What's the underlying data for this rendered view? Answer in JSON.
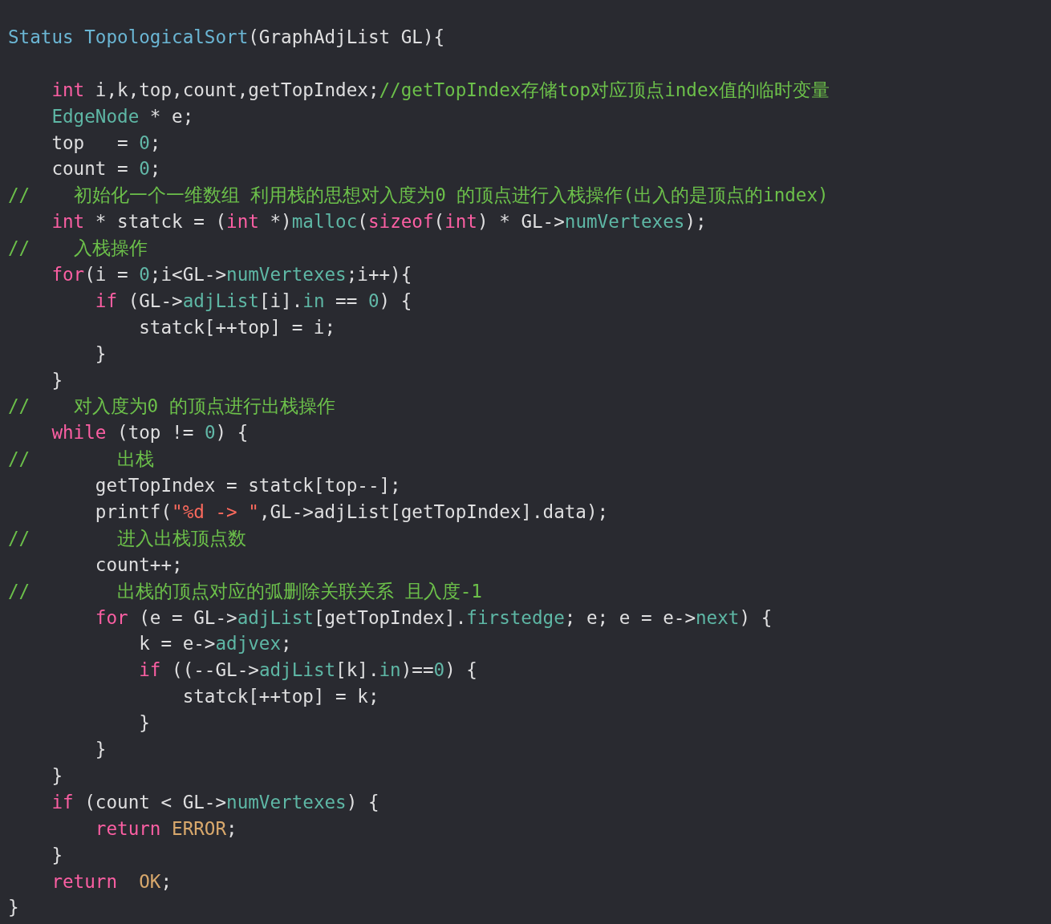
{
  "editor": {
    "header_line": [
      {
        "text": "Status ",
        "kind": "type"
      },
      {
        "text": "TopologicalSort",
        "kind": "type"
      },
      {
        "text": "(GraphAdjList GL){",
        "kind": "plain"
      }
    ],
    "lines": [
      [
        {
          "text": "    int",
          "kind": "keyword"
        },
        {
          "text": " i,k,top,count,getTopIndex;",
          "kind": "plain"
        },
        {
          "text": "//getTopIndex存储top对应顶点index值的临时变量",
          "kind": "comment"
        }
      ],
      [
        {
          "text": "    EdgeNode",
          "kind": "member"
        },
        {
          "text": " * e;",
          "kind": "plain"
        }
      ],
      [
        {
          "text": "    top   = ",
          "kind": "plain"
        },
        {
          "text": "0",
          "kind": "number"
        },
        {
          "text": ";",
          "kind": "plain"
        }
      ],
      [
        {
          "text": "    count = ",
          "kind": "plain"
        },
        {
          "text": "0",
          "kind": "number"
        },
        {
          "text": ";",
          "kind": "plain"
        }
      ],
      [
        {
          "text": "//    初始化一个一维数组 利用栈的思想对入度为0 的顶点进行入栈操作(出入的是顶点的index)",
          "kind": "comment"
        }
      ],
      [
        {
          "text": "    int",
          "kind": "keyword"
        },
        {
          "text": " * statck = (",
          "kind": "plain"
        },
        {
          "text": "int",
          "kind": "keyword"
        },
        {
          "text": " *)",
          "kind": "plain"
        },
        {
          "text": "malloc",
          "kind": "member"
        },
        {
          "text": "(",
          "kind": "plain"
        },
        {
          "text": "sizeof",
          "kind": "keyword"
        },
        {
          "text": "(",
          "kind": "plain"
        },
        {
          "text": "int",
          "kind": "keyword"
        },
        {
          "text": ") * GL->",
          "kind": "plain"
        },
        {
          "text": "numVertexes",
          "kind": "member"
        },
        {
          "text": ");",
          "kind": "plain"
        }
      ],
      [
        {
          "text": "//    入栈操作",
          "kind": "comment"
        }
      ],
      [
        {
          "text": "    for",
          "kind": "keyword"
        },
        {
          "text": "(i = ",
          "kind": "plain"
        },
        {
          "text": "0",
          "kind": "number"
        },
        {
          "text": ";i<GL->",
          "kind": "plain"
        },
        {
          "text": "numVertexes",
          "kind": "member"
        },
        {
          "text": ";i++){",
          "kind": "plain"
        }
      ],
      [
        {
          "text": "        if",
          "kind": "keyword"
        },
        {
          "text": " (GL->",
          "kind": "plain"
        },
        {
          "text": "adjList",
          "kind": "member"
        },
        {
          "text": "[i].",
          "kind": "plain"
        },
        {
          "text": "in",
          "kind": "member"
        },
        {
          "text": " == ",
          "kind": "plain"
        },
        {
          "text": "0",
          "kind": "number"
        },
        {
          "text": ") {",
          "kind": "plain"
        }
      ],
      [
        {
          "text": "            statck[++top] = i;",
          "kind": "plain"
        }
      ],
      [
        {
          "text": "        }",
          "kind": "plain"
        }
      ],
      [
        {
          "text": "    }",
          "kind": "plain"
        }
      ],
      [
        {
          "text": "//    对入度为0 的顶点进行出栈操作",
          "kind": "comment"
        }
      ],
      [
        {
          "text": "    while",
          "kind": "keyword"
        },
        {
          "text": " (top != ",
          "kind": "plain"
        },
        {
          "text": "0",
          "kind": "number"
        },
        {
          "text": ") {",
          "kind": "plain"
        }
      ],
      [
        {
          "text": "//        出栈",
          "kind": "comment"
        }
      ],
      [
        {
          "text": "        getTopIndex = statck[top--];",
          "kind": "plain"
        }
      ],
      [
        {
          "text": "        printf(",
          "kind": "plain"
        },
        {
          "text": "\"%d -> \"",
          "kind": "string"
        },
        {
          "text": ",GL->adjList[getTopIndex].data);",
          "kind": "plain"
        }
      ],
      [
        {
          "text": "//        进入出栈顶点数",
          "kind": "comment"
        }
      ],
      [
        {
          "text": "        count++;",
          "kind": "plain"
        }
      ],
      [
        {
          "text": "//        出栈的顶点对应的弧删除关联关系 且入度-1",
          "kind": "comment"
        }
      ],
      [
        {
          "text": "        for",
          "kind": "keyword"
        },
        {
          "text": " (e = GL->",
          "kind": "plain"
        },
        {
          "text": "adjList",
          "kind": "member"
        },
        {
          "text": "[getTopIndex].",
          "kind": "plain"
        },
        {
          "text": "firstedge",
          "kind": "member"
        },
        {
          "text": "; e; e = e->",
          "kind": "plain"
        },
        {
          "text": "next",
          "kind": "member"
        },
        {
          "text": ") {",
          "kind": "plain"
        }
      ],
      [
        {
          "text": "            k = e->",
          "kind": "plain"
        },
        {
          "text": "adjvex",
          "kind": "member"
        },
        {
          "text": ";",
          "kind": "plain"
        }
      ],
      [
        {
          "text": "            if",
          "kind": "keyword"
        },
        {
          "text": " ((--GL->",
          "kind": "plain"
        },
        {
          "text": "adjList",
          "kind": "member"
        },
        {
          "text": "[k].",
          "kind": "plain"
        },
        {
          "text": "in",
          "kind": "member"
        },
        {
          "text": ")==",
          "kind": "plain"
        },
        {
          "text": "0",
          "kind": "number"
        },
        {
          "text": ") {",
          "kind": "plain"
        }
      ],
      [
        {
          "text": "                statck[++top] = k;",
          "kind": "plain"
        }
      ],
      [
        {
          "text": "            }",
          "kind": "plain"
        }
      ],
      [
        {
          "text": "        }",
          "kind": "plain"
        }
      ],
      [
        {
          "text": "    }",
          "kind": "plain"
        }
      ],
      [
        {
          "text": "    if",
          "kind": "keyword"
        },
        {
          "text": " (count < GL->",
          "kind": "plain"
        },
        {
          "text": "numVertexes",
          "kind": "member"
        },
        {
          "text": ") {",
          "kind": "plain"
        }
      ],
      [
        {
          "text": "        return ",
          "kind": "keyword"
        },
        {
          "text": "ERROR",
          "kind": "macro"
        },
        {
          "text": ";",
          "kind": "plain"
        }
      ],
      [
        {
          "text": "    }",
          "kind": "plain"
        }
      ],
      [
        {
          "text": "    return  ",
          "kind": "keyword"
        },
        {
          "text": "OK",
          "kind": "macro"
        },
        {
          "text": ";",
          "kind": "plain"
        }
      ],
      [
        {
          "text": "}",
          "kind": "plain"
        }
      ]
    ]
  }
}
